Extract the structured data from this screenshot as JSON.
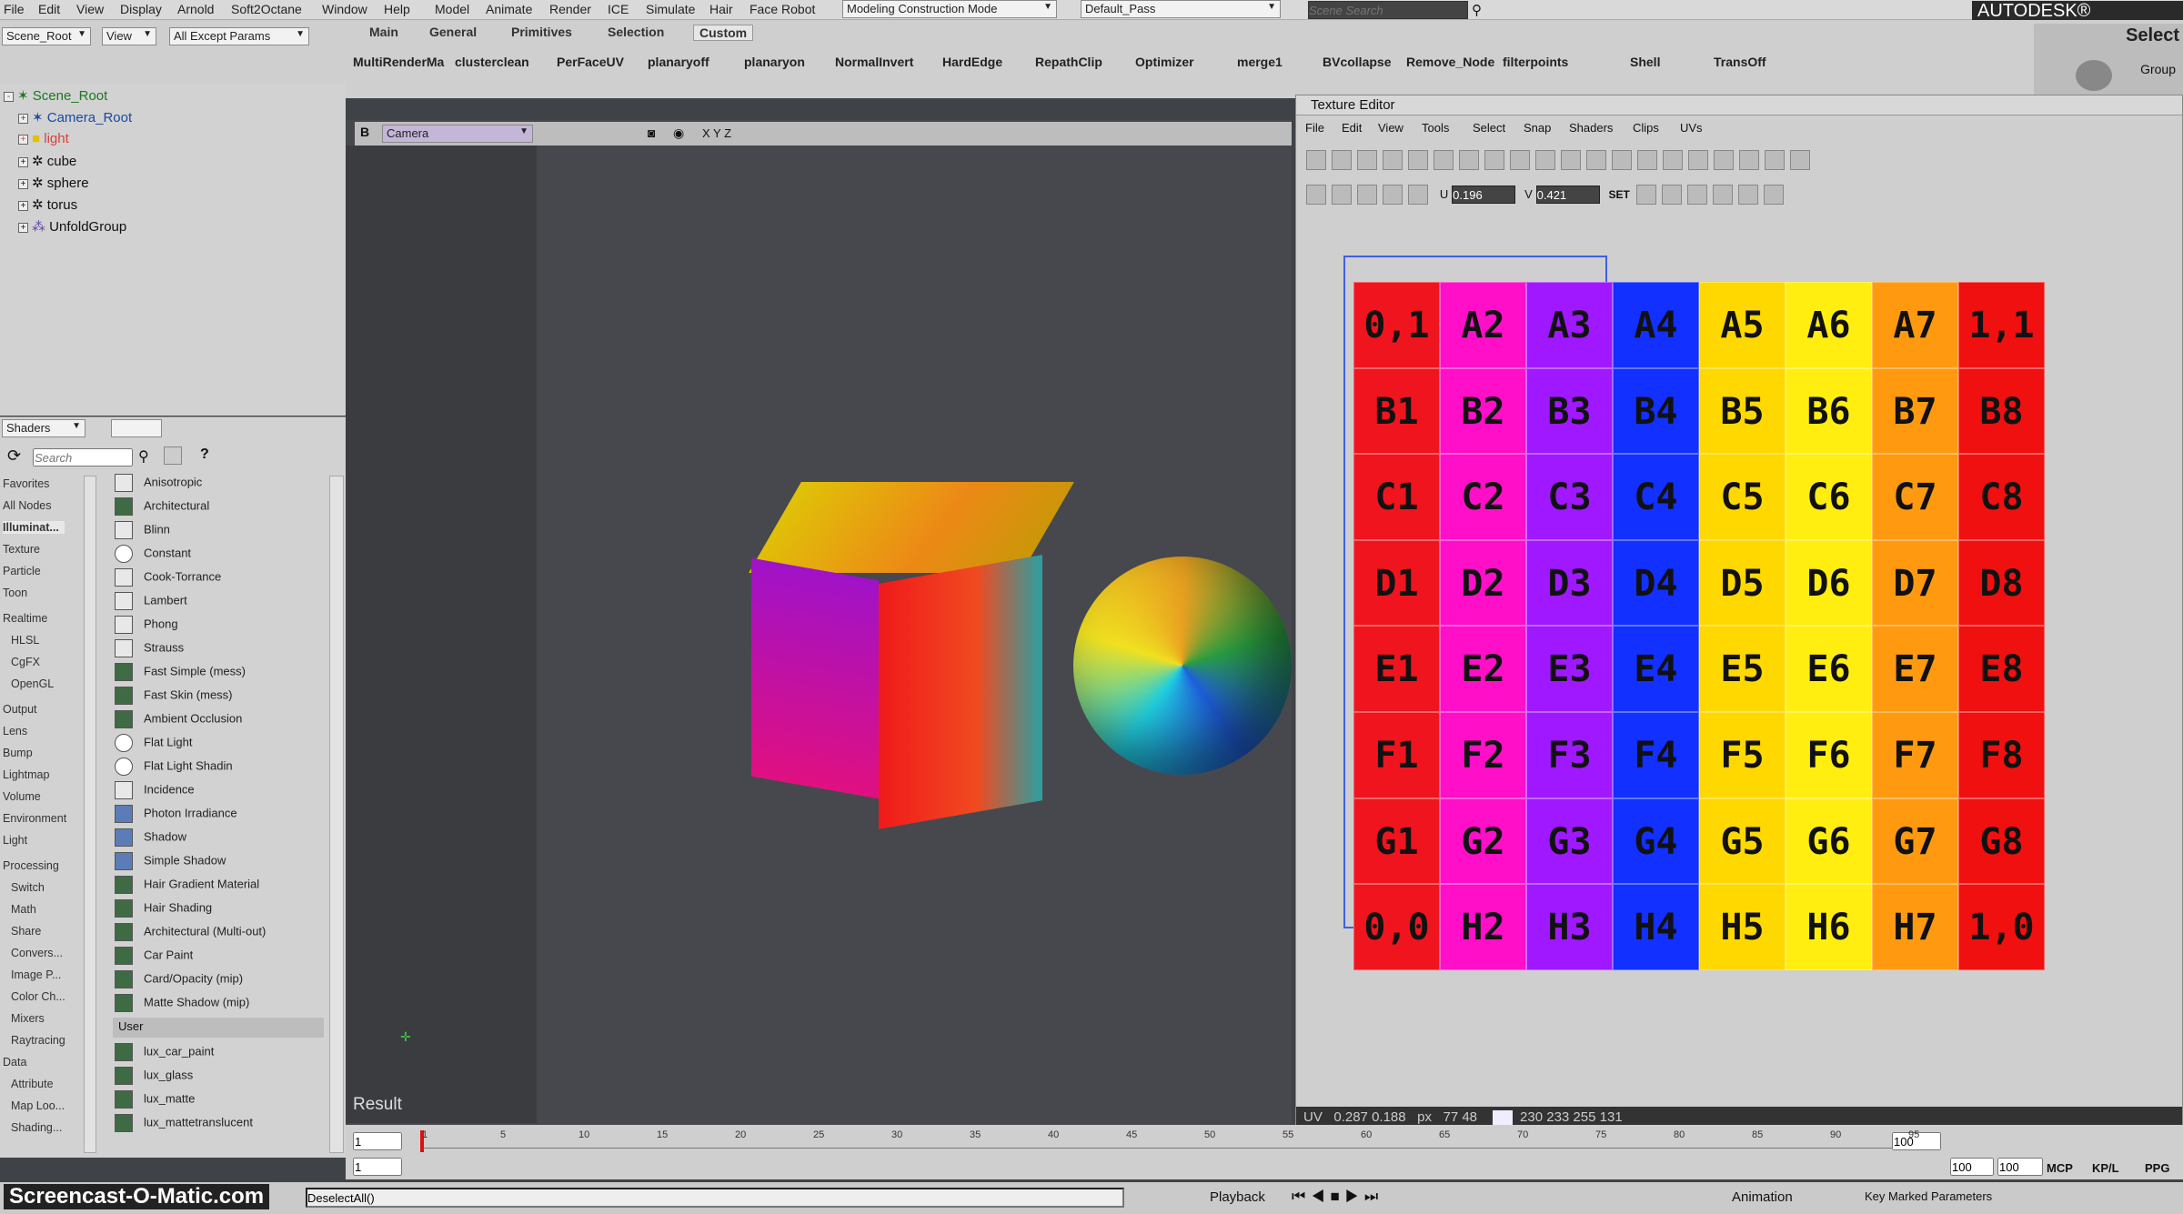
{
  "menubar": {
    "items": [
      "File",
      "Edit",
      "View",
      "Display",
      "Arnold",
      "Soft2Octane",
      "Window",
      "Help",
      "Model",
      "Animate",
      "Render",
      "ICE",
      "Simulate",
      "Hair",
      "Face Robot"
    ],
    "mode": "Modeling Construction Mode",
    "pass": "Default_Pass",
    "scene_search_placeholder": "Scene Search",
    "brand": "AUTODESK® SOFTIMAGE"
  },
  "toolbar": {
    "scene_root": "Scene_Root",
    "view": "View",
    "filter": "All Except Params",
    "tabs": [
      "Main",
      "General",
      "Primitives",
      "Selection",
      "Custom"
    ],
    "buttons": [
      "MultiRenderMa",
      "clusterclean",
      "PerFaceUV",
      "planaryoff",
      "planaryon",
      "NormalInvert",
      "HardEdge",
      "RepathClip",
      "Optimizer",
      "merge1",
      "BVcollapse",
      "Remove_Node",
      "filterpoints",
      "Shell",
      "TransOff"
    ],
    "select_title": "Select",
    "group": "Group"
  },
  "explorer": {
    "items": [
      "Scene_Root",
      "Camera_Root",
      "light",
      "cube",
      "sphere",
      "torus",
      "UnfoldGroup"
    ]
  },
  "shaders": {
    "dropdown": "Shaders",
    "search_placeholder": "Search",
    "categories": [
      "Favorites",
      "All Nodes",
      "Illuminat...",
      "Texture",
      "Particle",
      "Toon",
      "Realtime",
      "HLSL",
      "CgFX",
      "OpenGL",
      "Output",
      "Lens",
      "Bump",
      "Lightmap",
      "Volume",
      "Environment",
      "Light",
      "Processing",
      "Switch",
      "Math",
      "Share",
      "Convers...",
      "Image P...",
      "Color Ch...",
      "Mixers",
      "Raytracing",
      "Data",
      "Attribute",
      "Map Loo...",
      "Shading..."
    ],
    "nodes": [
      "Anisotropic",
      "Architectural",
      "Blinn",
      "Constant",
      "Cook-Torrance",
      "Lambert",
      "Phong",
      "Strauss",
      "Fast Simple (mess)",
      "Fast Skin (mess)",
      "Ambient Occlusion",
      "Flat Light",
      "Flat Light Shadin",
      "Incidence",
      "Photon Irradiance",
      "Shadow",
      "Simple Shadow",
      "Hair Gradient Material",
      "Hair Shading",
      "Architectural (Multi-out)",
      "Car Paint",
      "Card/Opacity (mip)",
      "Matte Shadow (mip)"
    ],
    "user_label": "User",
    "user_nodes": [
      "lux_car_paint",
      "lux_glass",
      "lux_matte",
      "lux_mattetranslucent"
    ]
  },
  "viewport": {
    "letter": "B",
    "camera": "Camera",
    "axes": "X Y Z",
    "result": "Result"
  },
  "texture_editor": {
    "title": "Texture Editor",
    "menu": [
      "File",
      "Edit",
      "View",
      "Tools",
      "Select",
      "Snap",
      "Shaders",
      "Clips",
      "UVs"
    ],
    "u_label": "U",
    "u_value": "0.196",
    "v_label": "V",
    "v_value": "0.421",
    "set": "SET",
    "status": {
      "uv_label": "UV",
      "uv": "0.287   0.188",
      "px_label": "px",
      "px": "77   48",
      "rgba": "230  233  255  131"
    },
    "rows": [
      "H",
      "G",
      "F",
      "E",
      "D",
      "C",
      "B",
      "A"
    ],
    "corner_labels": {
      "tl": "0,1",
      "tr": "1,1",
      "bl": "0,0",
      "br": "1,0"
    },
    "colors": [
      "#f0141e",
      "#ff0fc8",
      "#a018ff",
      "#1230ff",
      "#10e6ff",
      "#ffd800",
      "#ffee10",
      "#ff9a10",
      "#f01010",
      "#12c812"
    ]
  },
  "timeline": {
    "ticks": [
      "1",
      "5",
      "10",
      "15",
      "20",
      "25",
      "30",
      "35",
      "40",
      "45",
      "50",
      "55",
      "60",
      "65",
      "70",
      "75",
      "80",
      "85",
      "90",
      "95"
    ],
    "start": "1",
    "start2": "1",
    "end": "100",
    "end2": "100",
    "end3": "100"
  },
  "status": {
    "watermark": "Screencast-O-Matic.com",
    "command": "DeselectAll()",
    "playback": "Playback",
    "animation": "Animation",
    "key": "Key Marked Parameters",
    "mcp": "MCP",
    "kpl": "KP/L",
    "ppg": "PPG"
  }
}
